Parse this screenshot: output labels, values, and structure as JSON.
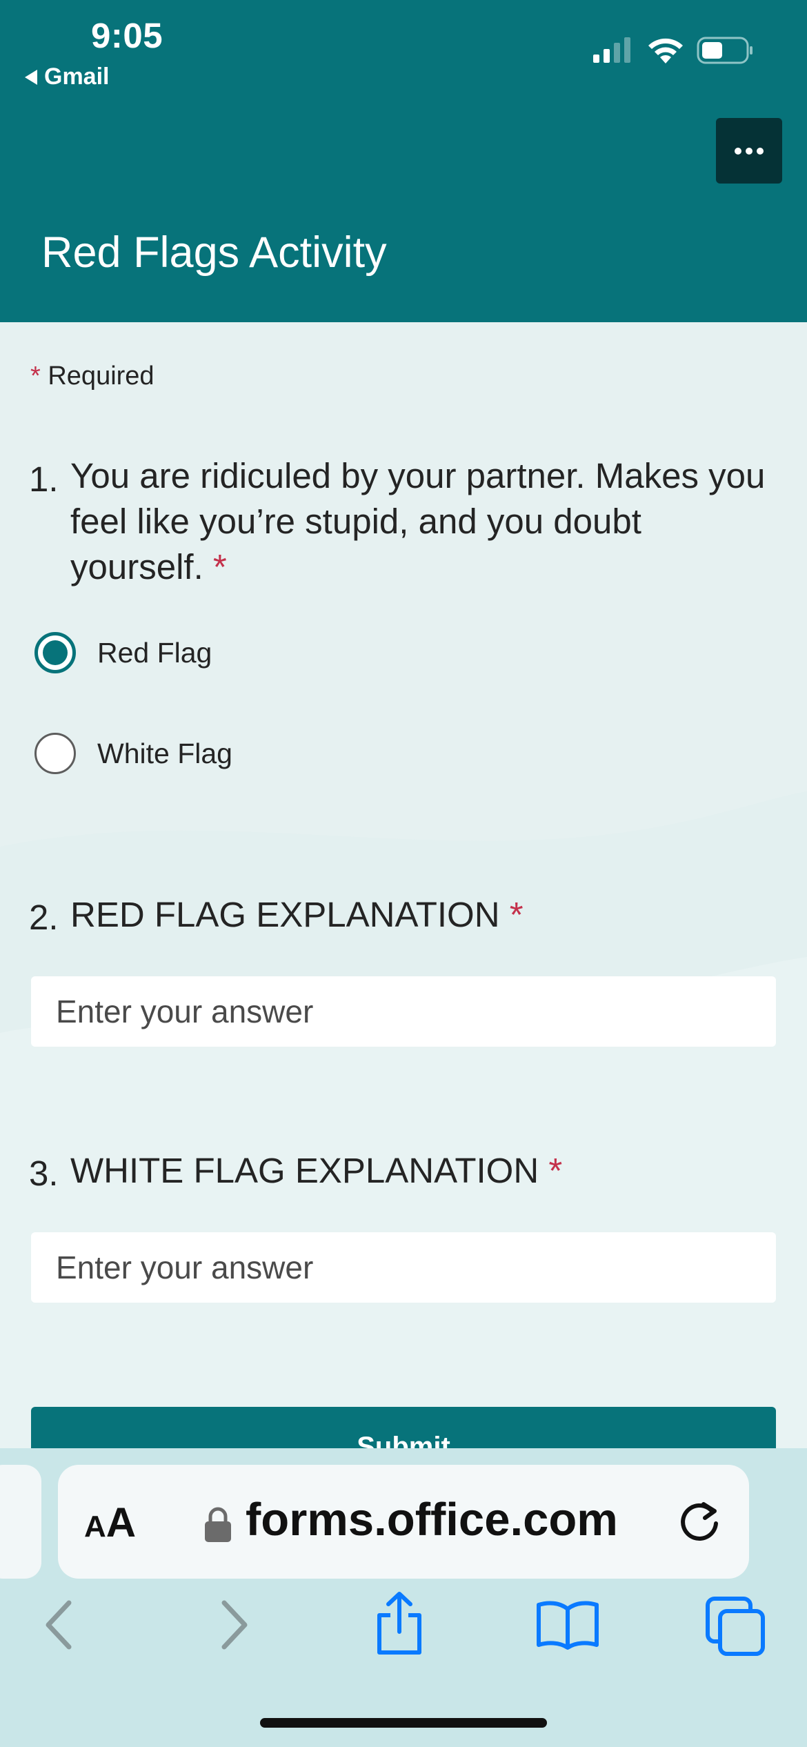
{
  "status_bar": {
    "time": "9:05",
    "back_app": "Gmail"
  },
  "form": {
    "title": "Red Flags Activity",
    "required_label": "Required",
    "required_marker": "*",
    "questions": [
      {
        "number": "1.",
        "text_lines": [
          "You are ridiculed by your partner. Makes you",
          "feel like you’re stupid, and you doubt",
          "yourself."
        ],
        "options": [
          {
            "label": "Red Flag",
            "selected": true
          },
          {
            "label": "White Flag",
            "selected": false
          }
        ]
      },
      {
        "number": "2.",
        "text": "RED FLAG EXPLANATION",
        "placeholder": "Enter your answer"
      },
      {
        "number": "3.",
        "text": "WHITE FLAG EXPLANATION",
        "placeholder": "Enter your answer"
      }
    ],
    "submit_label": "Submit"
  },
  "browser": {
    "text_size_small": "A",
    "text_size_large": "A",
    "url": "forms.office.com"
  },
  "colors": {
    "accent": "#07737a",
    "required": "#c4314b",
    "ios_blue": "#0a7aff"
  },
  "icons": [
    "signal-icon",
    "wifi-icon",
    "battery-icon",
    "more-icon",
    "lock-icon",
    "reload-icon",
    "back-arrow-icon",
    "forward-arrow-icon",
    "share-icon",
    "bookmarks-icon",
    "tabs-icon"
  ]
}
